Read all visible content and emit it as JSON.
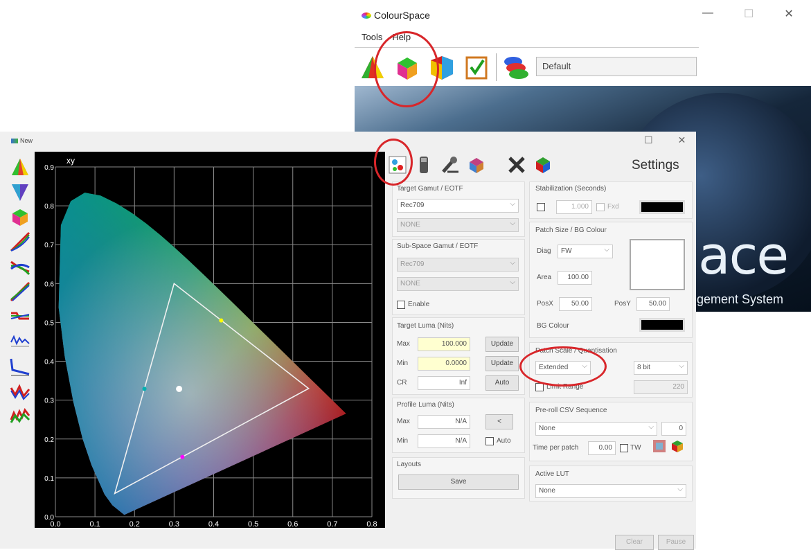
{
  "cs_window": {
    "title": "ColourSpace",
    "menu": [
      "Tools",
      "Help"
    ],
    "preset": "Default",
    "banner_text": "ace",
    "banner_subtext": "gement System",
    "minimize_glyph": "—",
    "maximize_glyph": "☐",
    "close_glyph": "✕"
  },
  "new_window": {
    "title": "New",
    "maximize_glyph": "☐",
    "close_glyph": "✕"
  },
  "chart_data": {
    "type": "scatter",
    "title": "xy",
    "xlim": [
      0,
      0.8
    ],
    "ylim": [
      0,
      0.9
    ],
    "x_ticks": [
      "0.0",
      "0.1",
      "0.2",
      "0.3",
      "0.4",
      "0.5",
      "0.6",
      "0.7",
      "0.8"
    ],
    "y_ticks": [
      "0.0",
      "0.1",
      "0.2",
      "0.3",
      "0.4",
      "0.5",
      "0.6",
      "0.7",
      "0.8",
      "0.9"
    ],
    "grid": true,
    "gamut_triangle": [
      [
        0.3,
        0.6
      ],
      [
        0.64,
        0.33
      ],
      [
        0.15,
        0.06
      ]
    ],
    "points": [
      {
        "x": 0.3127,
        "y": 0.329,
        "color": "#ffffff"
      },
      {
        "x": 0.419,
        "y": 0.505,
        "color": "#ffff00"
      },
      {
        "x": 0.225,
        "y": 0.329,
        "color": "#00b0b0"
      },
      {
        "x": 0.321,
        "y": 0.154,
        "color": "#ff00ff"
      }
    ]
  },
  "settings": {
    "title": "Settings",
    "target_gamut": {
      "label": "Target Gamut / EOTF",
      "gamut": "Rec709",
      "eotf": "NONE"
    },
    "subspace": {
      "label": "Sub-Space Gamut / EOTF",
      "gamut": "Rec709",
      "eotf": "NONE",
      "enable_label": "Enable"
    },
    "target_luma": {
      "label": "Target Luma (Nits)",
      "max_label": "Max",
      "max_value": "100.000",
      "min_label": "Min",
      "min_value": "0.0000",
      "cr_label": "CR",
      "cr_value": "Inf",
      "update1": "Update",
      "update2": "Update",
      "auto": "Auto"
    },
    "profile_luma": {
      "label": "Profile Luma (Nits)",
      "max_label": "Max",
      "max_value": "N/A",
      "min_label": "Min",
      "min_value": "N/A",
      "btn": "<",
      "auto_label": "Auto"
    },
    "layouts": {
      "label": "Layouts",
      "save": "Save"
    },
    "stabilization": {
      "label": "Stabilization (Seconds)",
      "value": "1.000",
      "fixed_label": "Fxd"
    },
    "patch": {
      "label": "Patch Size / BG Colour",
      "diag_label": "Diag",
      "diag_value": "FW",
      "area_label": "Area",
      "area_value": "100.00",
      "posx_label": "PosX",
      "posx_value": "50.00",
      "posy_label": "PosY",
      "posy_value": "50.00",
      "bg_label": "BG Colour"
    },
    "patch_scale": {
      "label": "Patch Scale / Quantisation",
      "scale": "Extended",
      "bits": "8 bit",
      "limit_label": "Limit Range",
      "limit_value": "220"
    },
    "preroll": {
      "label": "Pre-roll CSV Sequence",
      "value": "None",
      "count": "0",
      "time_label": "Time per patch",
      "time_value": "0.00",
      "tw_label": "TW"
    },
    "active_lut": {
      "label": "Active LUT",
      "value": "None"
    },
    "footer": {
      "clear": "Clear",
      "pause": "Pause"
    }
  },
  "annotation_color": "#d8262a"
}
